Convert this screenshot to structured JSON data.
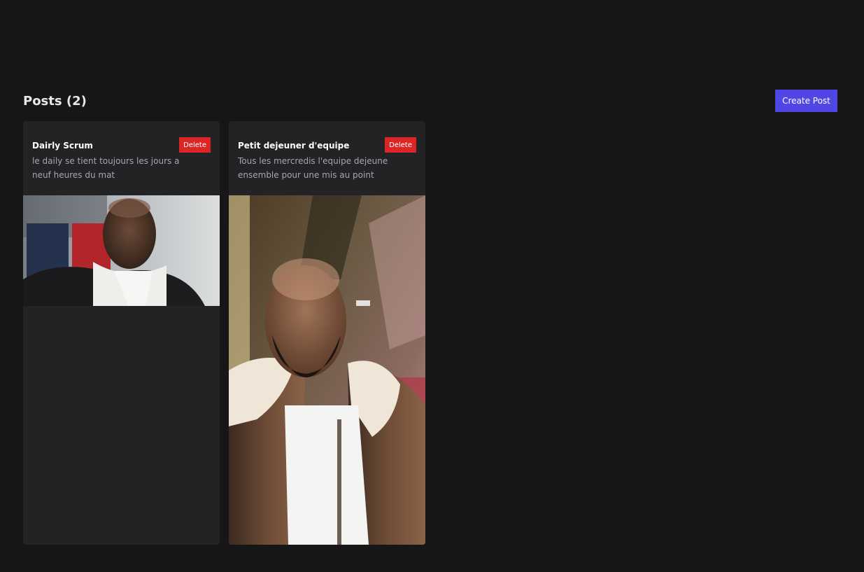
{
  "header": {
    "title": "Posts (2)",
    "create_label": "Create Post"
  },
  "posts": [
    {
      "title": "Dairly Scrum",
      "description": "le daily se tient toujours les jours a neuf heures du mat",
      "delete_label": "Delete",
      "image": "selfie photo of man in train seat"
    },
    {
      "title": "Petit dejeuner d'equipe",
      "description": "Tous les mercredis l'equipe dejeune ensemble pour une mis au point",
      "delete_label": "Delete",
      "image": "selfie photo of man in train"
    }
  ],
  "colors": {
    "background": "#161616",
    "card": "#232326",
    "accent": "#4f46e5",
    "danger": "#dc2626"
  }
}
